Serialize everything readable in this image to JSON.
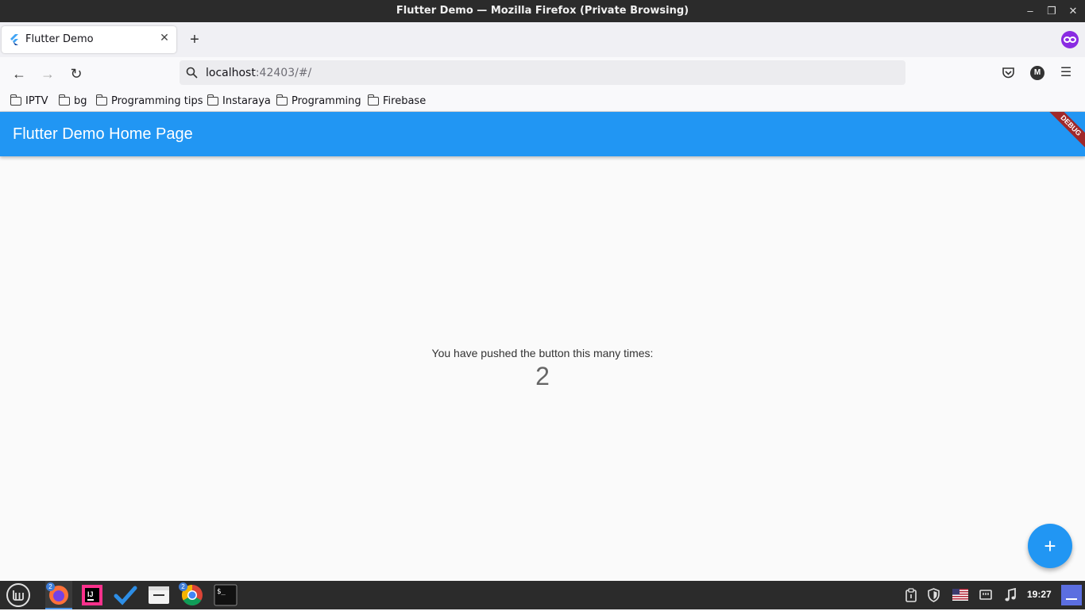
{
  "window": {
    "title": "Flutter Demo — Mozilla Firefox (Private Browsing)",
    "controls": {
      "minimize": "–",
      "restore": "❐",
      "close": "✕"
    }
  },
  "browser": {
    "tab": {
      "label": "Flutter Demo",
      "close_glyph": "✕"
    },
    "new_tab_glyph": "+",
    "nav": {
      "back": "←",
      "forward": "→",
      "reload": "↻"
    },
    "url": {
      "host": "localhost",
      "rest": ":42403/#/"
    },
    "toolbar_right": {
      "profile_initial": "M",
      "menu_glyph": "☰"
    },
    "bookmarks": [
      "IPTV",
      "bg",
      "Programming tips",
      "Instaraya",
      "Programming",
      "Firebase"
    ]
  },
  "app": {
    "appbar_title": "Flutter Demo Home Page",
    "debug_banner": "DEBUG",
    "message": "You have pushed the button this many times:",
    "counter": "2",
    "fab_glyph": "+"
  },
  "taskbar": {
    "badges": {
      "firefox": "2",
      "chrome": "2"
    },
    "clock": "19:27"
  },
  "colors": {
    "primary": "#2196f3",
    "titlebar": "#2b2b2b",
    "debug": "#a0282a",
    "private_browsing": "#8a2be2"
  }
}
